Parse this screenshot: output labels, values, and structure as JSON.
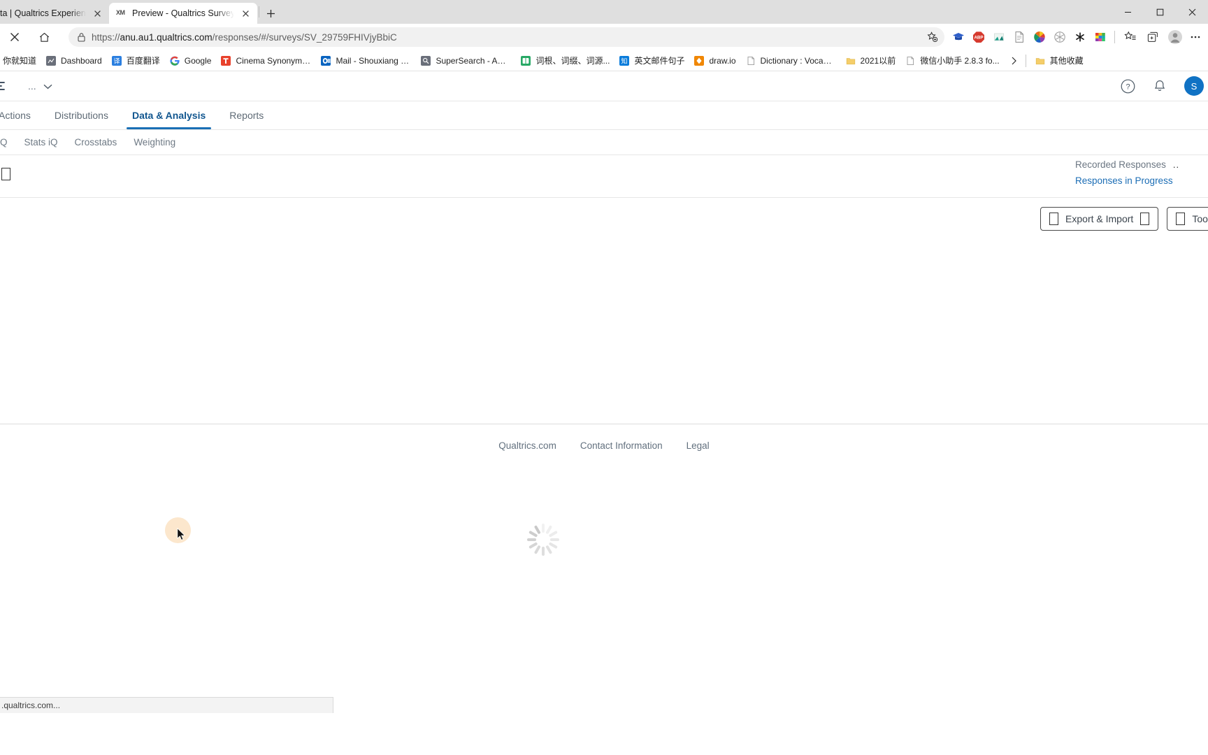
{
  "browser": {
    "tabs": [
      {
        "title": "ta | Qualtrics Experience Mana",
        "favicon": "xm-icon",
        "active": false
      },
      {
        "title": "Preview - Qualtrics Survey | Qua",
        "favicon": "xm-icon",
        "active": true
      }
    ],
    "new_tab_label": "+",
    "window_controls": {
      "minimize": "—",
      "maximize": "❐",
      "close": "✕"
    },
    "nav": {
      "stop_label": "✕",
      "home_label": "home-icon",
      "lock_label": "lock-icon",
      "url_prefix": "https://",
      "url_host": "anu.au1.qualtrics.com",
      "url_path": "/responses/#/surveys/SV_29759FHIVjyBbiC",
      "favorite_label": "add-favorite-icon"
    },
    "extensions": [
      {
        "name": "graduation-cap-extension"
      },
      {
        "name": "adblock-plus-extension",
        "label": "ABP"
      },
      {
        "name": "translate-extension"
      },
      {
        "name": "document-extension"
      },
      {
        "name": "color-wheel-extension"
      },
      {
        "name": "snowflake-extension"
      },
      {
        "name": "asterisk-extension",
        "label": "✱"
      },
      {
        "name": "palette-extension"
      }
    ],
    "toolbar": {
      "collections_label": "collections-icon",
      "favorites_label": "favorites-icon",
      "profile_label": "profile-icon",
      "settings_label": "more-icon"
    },
    "bookmarks": [
      {
        "label": "你就知道",
        "icon": "cn-site-icon",
        "color": "#ffffff"
      },
      {
        "label": "Dashboard",
        "icon": "dashboard-icon",
        "color": "#6a6f7a"
      },
      {
        "label": "百度翻译",
        "icon": "baidu-translate-icon",
        "color": "#2b7fe0"
      },
      {
        "label": "Google",
        "icon": "google-icon",
        "color": "#ffffff"
      },
      {
        "label": "Cinema Synonyms,...",
        "icon": "cinema-icon",
        "color": "#e8412c"
      },
      {
        "label": "Mail - Shouxiang Qi...",
        "icon": "outlook-icon",
        "color": "#0a64c0"
      },
      {
        "label": "SuperSearch - ANU...",
        "icon": "supersearch-icon",
        "color": "#6a6f7a"
      },
      {
        "label": "词根、词缀、词源...",
        "icon": "dictionary-cn-icon",
        "color": "#27a865"
      },
      {
        "label": "英文邮件句子",
        "icon": "zhihu-icon",
        "color": "#0a7cdb"
      },
      {
        "label": "draw.io",
        "icon": "drawio-icon",
        "color": "#f08705"
      },
      {
        "label": "Dictionary : Vocabul...",
        "icon": "page-icon",
        "color": "#ffffff"
      },
      {
        "label": "2021以前",
        "icon": "folder-icon",
        "color": "#f5ce6a"
      },
      {
        "label": "微信小助手 2.8.3 fo...",
        "icon": "page-icon",
        "color": "#ffffff"
      }
    ],
    "bookmarks_overflow_label": "›",
    "other_favorites": {
      "label": "其他收藏",
      "icon": "folder-icon"
    },
    "status_bar_text": ".qualtrics.com..."
  },
  "qualtrics": {
    "project_menu_label": "...",
    "project_caret": "⌄",
    "help_icon": "help-icon",
    "notifications_icon": "bell-icon",
    "avatar_initial": "S",
    "tabs": [
      {
        "label": "Actions",
        "selected": false
      },
      {
        "label": "Distributions",
        "selected": false
      },
      {
        "label": "Data & Analysis",
        "selected": true
      },
      {
        "label": "Reports",
        "selected": false
      }
    ],
    "subtabs": [
      {
        "label": "Q"
      },
      {
        "label": "Stats iQ"
      },
      {
        "label": "Crosstabs"
      },
      {
        "label": "Weighting"
      }
    ],
    "response_views": [
      {
        "label": "Recorded Responses",
        "type": "muted",
        "trailing": ".."
      },
      {
        "label": "Responses in Progress",
        "type": "link",
        "trailing": ""
      }
    ],
    "action_buttons": [
      {
        "label": "Export & Import",
        "leading_icon": "tofu-glyph",
        "trailing_icon": "tofu-glyph"
      },
      {
        "label": "Tools",
        "leading_icon": "tofu-glyph",
        "trailing_icon": "tofu-glyph"
      }
    ],
    "loading": {
      "state": "spinner",
      "label": "loading-spinner"
    },
    "footer_links": [
      "Qualtrics.com",
      "Contact Information",
      "Legal"
    ]
  },
  "colors": {
    "accent_blue": "#1a6fb5",
    "link_blue": "#1b6db5",
    "avatar_blue": "#1072c4",
    "chrome_gray": "#dfdfdf",
    "cursor_halo": "#fbe3c4"
  }
}
